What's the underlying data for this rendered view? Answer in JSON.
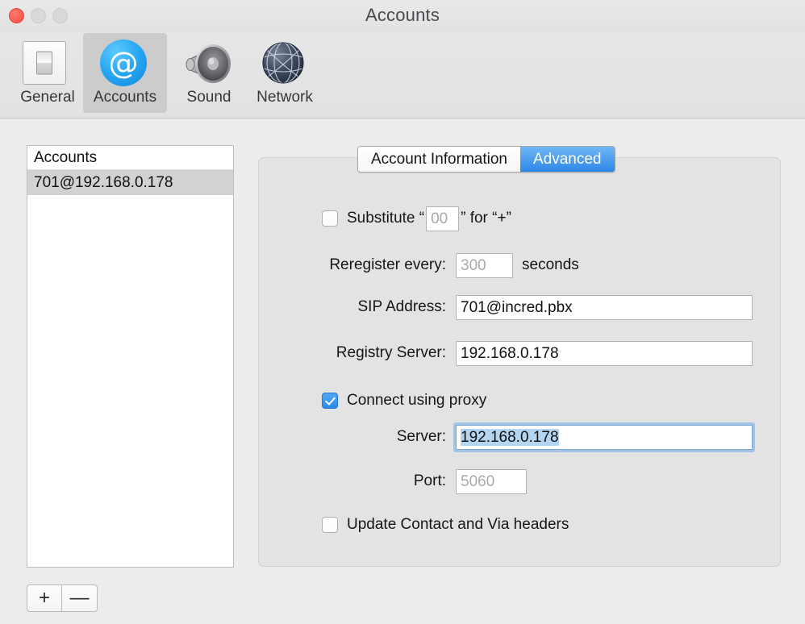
{
  "window": {
    "title": "Accounts",
    "controls": {
      "close": "close-button",
      "minimize": "minimize-button",
      "maximize": "maximize-button"
    }
  },
  "toolbar": {
    "items": [
      {
        "label": "General",
        "icon": "switch-icon",
        "selected": false
      },
      {
        "label": "Accounts",
        "icon": "at-sign-icon",
        "selected": true
      },
      {
        "label": "Sound",
        "icon": "speaker-icon",
        "selected": false
      },
      {
        "label": "Network",
        "icon": "globe-icon",
        "selected": false
      }
    ]
  },
  "accounts_list": {
    "header": "Accounts",
    "rows": [
      {
        "label": "701@192.168.0.178",
        "selected": true
      }
    ],
    "add_button": "+",
    "remove_button": "—"
  },
  "tabs": [
    {
      "label": "Account Information",
      "active": false
    },
    {
      "label": "Advanced",
      "active": true
    }
  ],
  "advanced": {
    "substitute": {
      "checked": false,
      "label_before": "Substitute “",
      "value": "00",
      "is_placeholder": true,
      "label_after": "” for “+”"
    },
    "reregister": {
      "label": "Reregister every:",
      "value": "300",
      "is_placeholder": true,
      "suffix": "seconds"
    },
    "sip_address": {
      "label": "SIP Address:",
      "value": "701@incred.pbx",
      "is_placeholder": false
    },
    "registry_server": {
      "label": "Registry Server:",
      "value": "192.168.0.178",
      "is_placeholder": false
    },
    "connect_using_proxy": {
      "label": "Connect using proxy",
      "checked": true
    },
    "proxy_server": {
      "label": "Server:",
      "value": "192.168.0.178",
      "is_placeholder": false,
      "focused": true,
      "text_selected": true
    },
    "proxy_port": {
      "label": "Port:",
      "value": "5060",
      "is_placeholder": true
    },
    "update_headers": {
      "label": "Update Contact and Via headers",
      "checked": false
    }
  },
  "colors": {
    "accent_blue": "#2e87e8",
    "selection_blue": "#b4d5f0",
    "window_bg": "#ececec",
    "panel_bg": "#e3e3e3",
    "close_red": "#fc5f55"
  }
}
